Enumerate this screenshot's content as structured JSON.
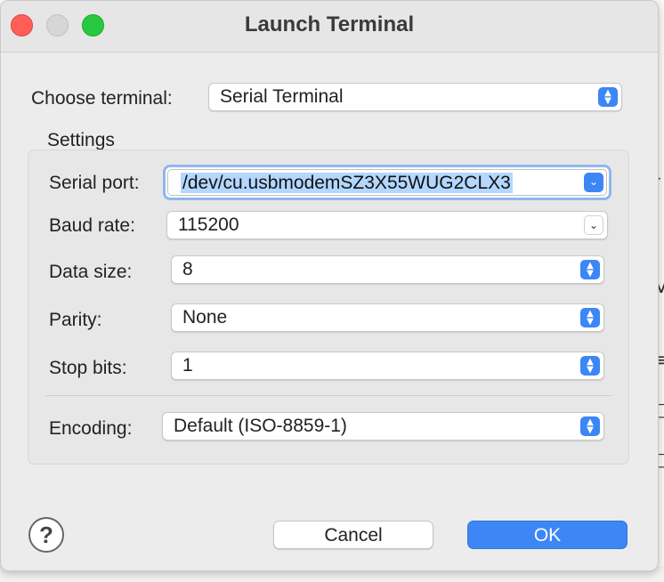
{
  "window": {
    "title": "Launch Terminal"
  },
  "terminal": {
    "label": "Choose terminal:",
    "value": "Serial Terminal"
  },
  "settings": {
    "group_label": "Settings",
    "serial_port": {
      "label": "Serial port:",
      "value": "/dev/cu.usbmodemSZ3X55WUG2CLX3"
    },
    "baud_rate": {
      "label": "Baud rate:",
      "value": "115200"
    },
    "data_size": {
      "label": "Data size:",
      "value": "8"
    },
    "parity": {
      "label": "Parity:",
      "value": "None"
    },
    "stop_bits": {
      "label": "Stop bits:",
      "value": "1"
    },
    "encoding": {
      "label": "Encoding:",
      "value": "Default (ISO-8859-1)"
    }
  },
  "buttons": {
    "help": "?",
    "cancel": "Cancel",
    "ok": "OK"
  },
  "icons": {
    "stepper": "up-down-chevron-icon",
    "dropdown": "chevron-down-icon"
  },
  "colors": {
    "accent": "#3d86f5",
    "close": "#ff5f57",
    "minimize": "#d6d6d6",
    "maximize": "#28c840"
  }
}
